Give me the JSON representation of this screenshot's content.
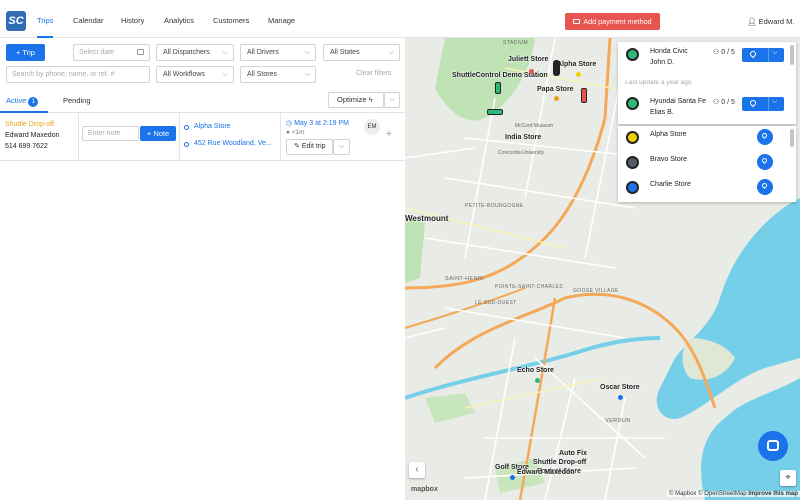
{
  "app": {
    "logo_text": "SC",
    "user": "Edward M."
  },
  "nav": [
    "Trips",
    "Calendar",
    "History",
    "Analytics",
    "Customers",
    "Manage"
  ],
  "header": {
    "payment_button": "Add payment method"
  },
  "toolbar": {
    "add_trip": "Trip",
    "select_date_placeholder": "Select date",
    "dispatchers": "All Dispatchers",
    "drivers": "All Drivers",
    "states": "All States",
    "search_placeholder": "Search by phone, name, or ref. #",
    "workflows": "All Workflows",
    "stores": "All Stores",
    "clear_filters": "Clear filters"
  },
  "tabs": {
    "active": "Active",
    "active_count": "1",
    "pending": "Pending",
    "optimize": "Optimize"
  },
  "trip": {
    "type": "Shuttle Drop-off",
    "customer": "Edward Maxedon",
    "phone": "514 699 7622",
    "note_placeholder": "Enter note",
    "note_button": "Note",
    "pickup": "Alpha Store",
    "dropoff": "452 Rue Woodland, Ve...",
    "time": "May 3 at 2:19 PM",
    "eta": "<1m",
    "edit": "Edit trip",
    "driver_initials": "EM"
  },
  "vehicles": [
    {
      "name": "Honda Civic",
      "driver": "John D.",
      "capacity": "0 / 5",
      "color": "#2db87a"
    },
    {
      "name": "Hyundai Santa Fe",
      "driver": "Elias B.",
      "capacity": "0 / 5",
      "color": "#2db87a"
    }
  ],
  "vehicle_panel": {
    "last_update": "Last update a year ago"
  },
  "stores": [
    {
      "name": "Alpha Store",
      "color": "#f0d200"
    },
    {
      "name": "Bravo Store",
      "color": "#555b66"
    },
    {
      "name": "Charlie Store",
      "color": "#1a73e8"
    }
  ],
  "map": {
    "labels": [
      "Juliett Store",
      "Alpha Store",
      "ShuttleControl Demo Station",
      "Papa Store",
      "India Store",
      "Echo Store",
      "Oscar Store",
      "Auto Fix",
      "Shuttle Drop-off",
      "Golf Store",
      "Foxtrot Store",
      "Edward Maxedon"
    ],
    "areas": [
      "Westmount",
      "SAINT-HENRI",
      "VERDUN",
      "POINTE-SAINT-CHARLES",
      "LE SUD-OUEST",
      "STADIUM",
      "Concordia University",
      "McCord Museum",
      "PETITE-BOURGOGNE",
      "GOOSE VILLAGE"
    ],
    "attribution": "© Mapbox © OpenStreetMap",
    "improve": "Improve this map",
    "mapbox": "mapbox"
  }
}
